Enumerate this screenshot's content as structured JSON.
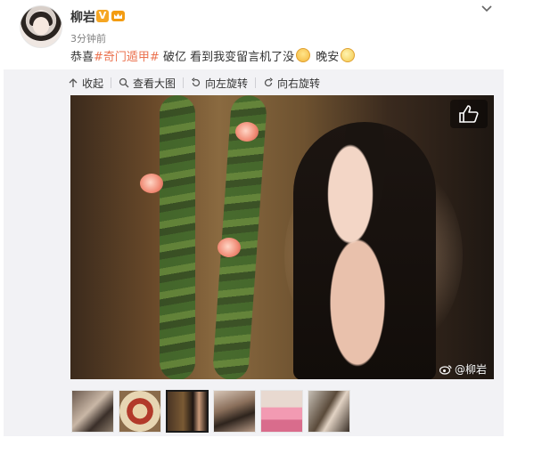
{
  "post": {
    "author": "柳岩",
    "verified_badge": "V",
    "time": "3分钟前",
    "text_prefix": "恭喜",
    "hashtag": "#奇门遁甲#",
    "text_mid": "破亿 看到我变留言机了没",
    "text_end": "晚安",
    "icons": [
      "verified-badge",
      "crown-icon",
      "chevron-down-icon",
      "smile-emoji",
      "wave-emoji"
    ]
  },
  "media": {
    "toolbar": {
      "collapse": "收起",
      "view_large": "查看大图",
      "rotate_left": "向左旋转",
      "rotate_right": "向右旋转"
    },
    "watermark": "@柳岩",
    "thumbnails": [
      {
        "label": "thumb-1",
        "active": false
      },
      {
        "label": "thumb-2",
        "active": false
      },
      {
        "label": "thumb-3",
        "active": true
      },
      {
        "label": "thumb-4",
        "active": false
      },
      {
        "label": "thumb-5",
        "active": false
      },
      {
        "label": "thumb-6",
        "active": false
      }
    ]
  },
  "colors": {
    "hashtag": "#eb7350",
    "badge": "#f5a623",
    "card_bg": "#f2f2f5"
  }
}
